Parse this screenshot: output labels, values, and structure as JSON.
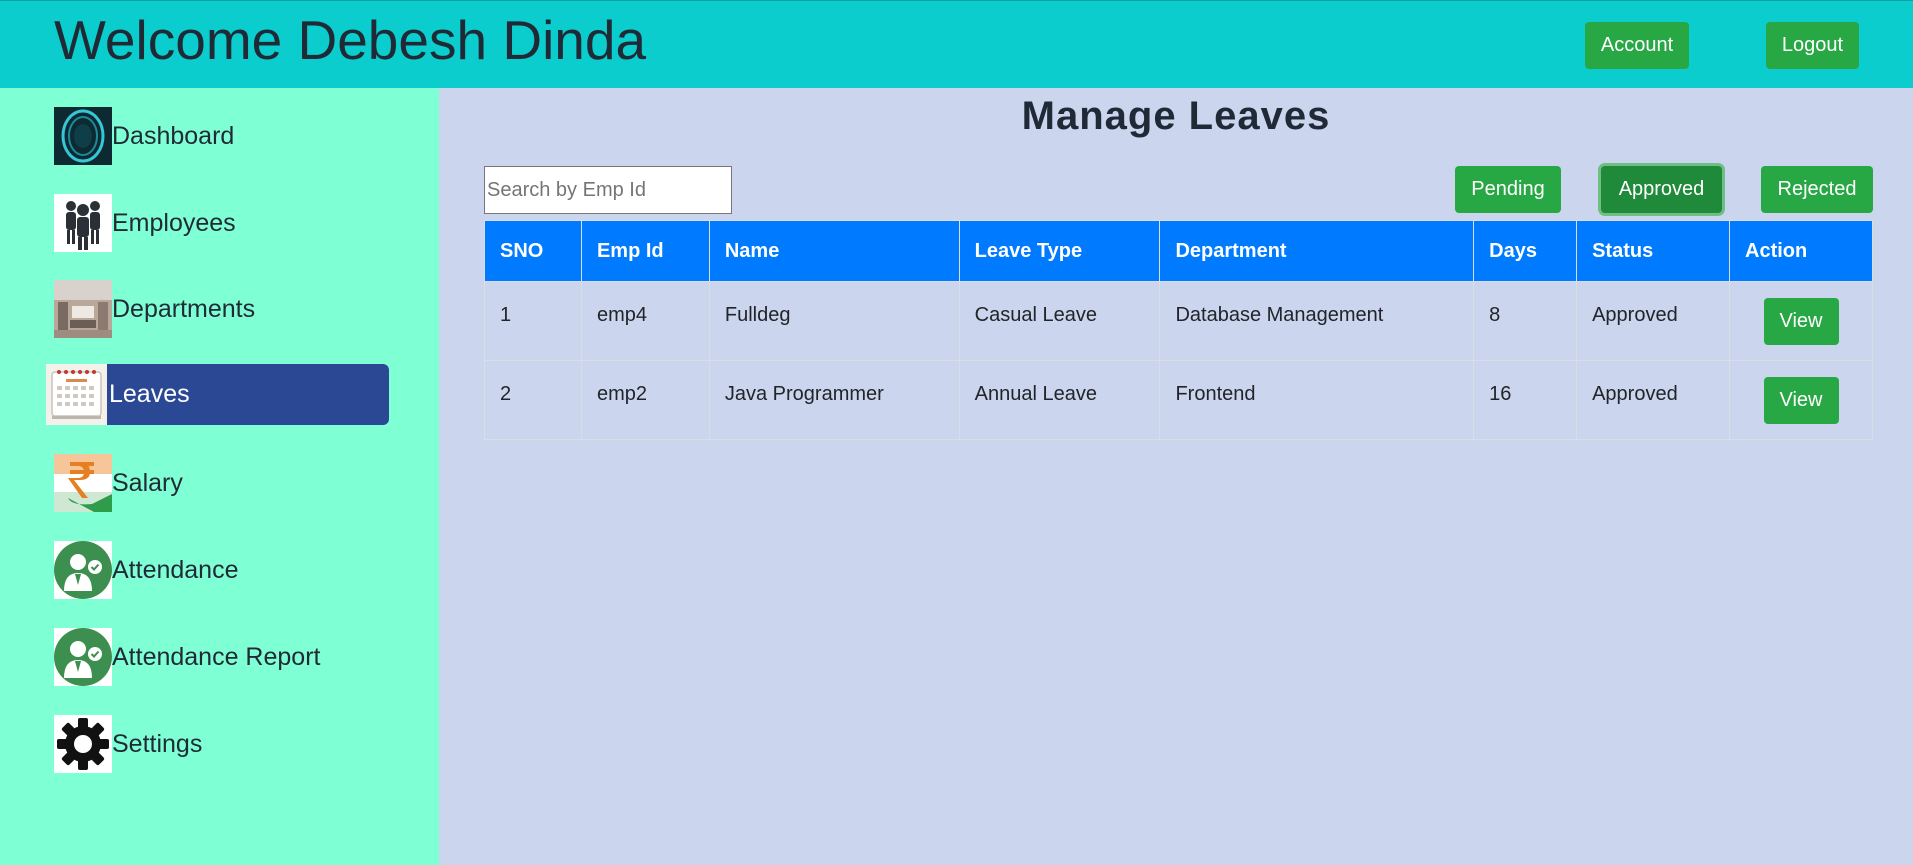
{
  "header": {
    "welcome": "Welcome Debesh Dinda",
    "account_label": "Account",
    "logout_label": "Logout"
  },
  "sidebar": {
    "items": [
      {
        "label": "Dashboard",
        "icon": "dashboard-icon"
      },
      {
        "label": "Employees",
        "icon": "employees-icon"
      },
      {
        "label": "Departments",
        "icon": "departments-icon"
      },
      {
        "label": "Leaves",
        "icon": "calendar-icon",
        "active": true
      },
      {
        "label": "Salary",
        "icon": "rupee-icon"
      },
      {
        "label": "Attendance",
        "icon": "attendance-icon"
      },
      {
        "label": "Attendance Report",
        "icon": "attendance-report-icon"
      },
      {
        "label": "Settings",
        "icon": "gear-icon"
      }
    ]
  },
  "main": {
    "title": "Manage Leaves",
    "search_placeholder": "Search by Emp Id",
    "filters": {
      "pending": "Pending",
      "approved": "Approved",
      "rejected": "Rejected",
      "selected": "Approved"
    },
    "table": {
      "headers": [
        "SNO",
        "Emp Id",
        "Name",
        "Leave Type",
        "Department",
        "Days",
        "Status",
        "Action"
      ],
      "rows": [
        {
          "sno": "1",
          "emp_id": "emp4",
          "name": "Fulldeg",
          "leave_type": "Casual Leave",
          "department": "Database Management",
          "days": "8",
          "status": "Approved",
          "action": "View"
        },
        {
          "sno": "2",
          "emp_id": "emp2",
          "name": "Java Programmer",
          "leave_type": "Annual Leave",
          "department": "Frontend",
          "days": "16",
          "status": "Approved",
          "action": "View"
        }
      ]
    }
  },
  "colors": {
    "header_bg": "#0bcdcd",
    "sidebar_bg": "#7fffd4",
    "main_bg": "#cbd5ee",
    "active_item_bg": "#2a4894",
    "button_green": "#28a745",
    "table_header_bg": "#007bff"
  }
}
